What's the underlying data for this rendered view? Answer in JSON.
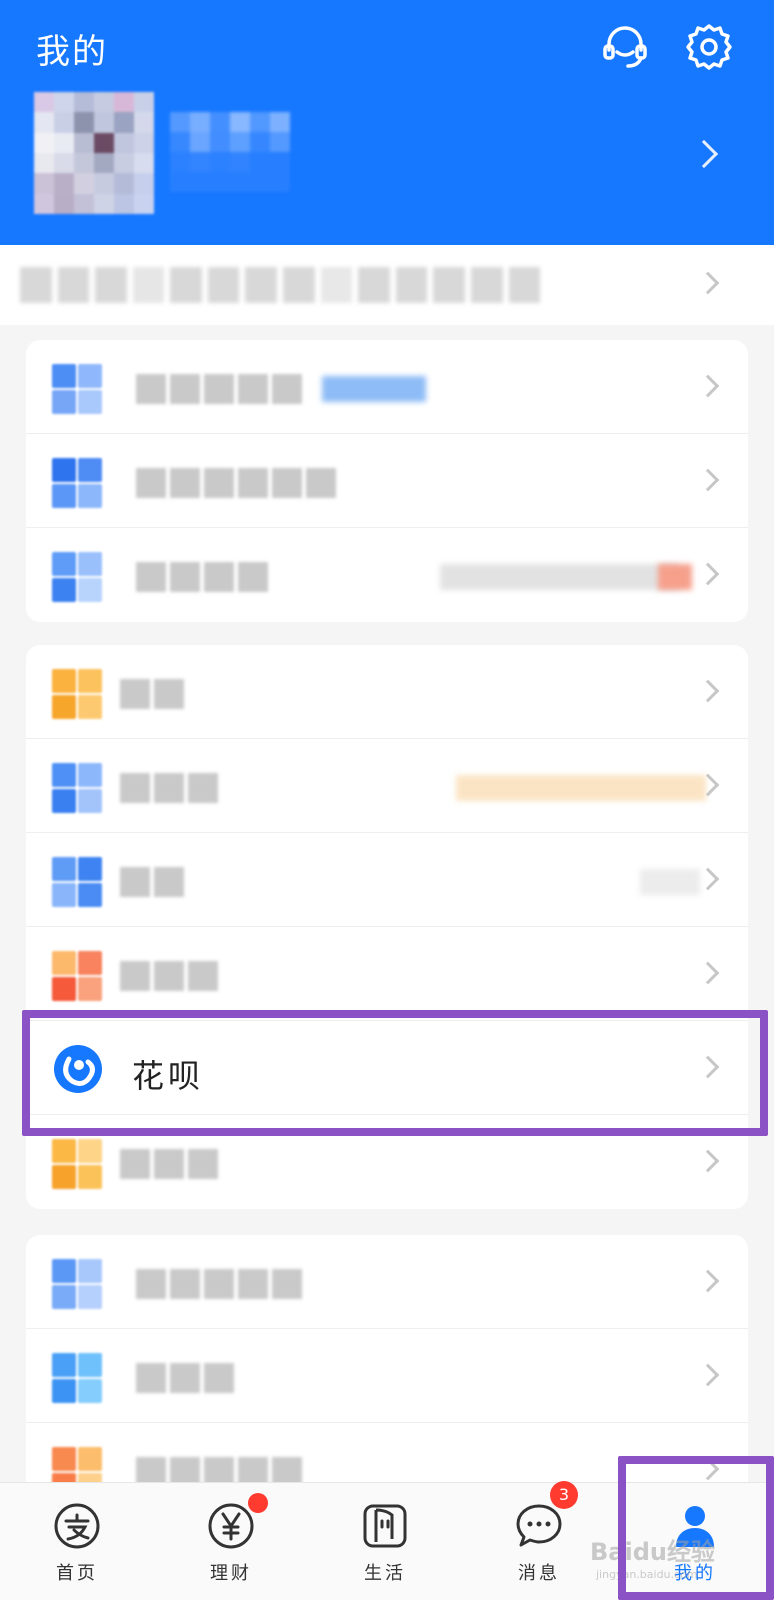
{
  "header": {
    "title": "我的",
    "background": "#1677ff"
  },
  "huabei": {
    "label": "花呗",
    "color": "#1677ff"
  },
  "tabbar": {
    "tabs": [
      {
        "label": "首页",
        "icon": "alipay-home-icon"
      },
      {
        "label": "理财",
        "icon": "yen-icon",
        "dot": true
      },
      {
        "label": "生活",
        "icon": "life-icon"
      },
      {
        "label": "消息",
        "icon": "chat-bubble-icon",
        "badge": "3"
      },
      {
        "label": "我的",
        "icon": "user-icon",
        "active": true
      }
    ]
  },
  "watermark": {
    "text": "Baidu经验",
    "sub": "jingyan.baidu.com"
  },
  "colors": {
    "accent": "#1677ff",
    "highlight": "#8a52c4",
    "badge": "#ff3b30"
  }
}
